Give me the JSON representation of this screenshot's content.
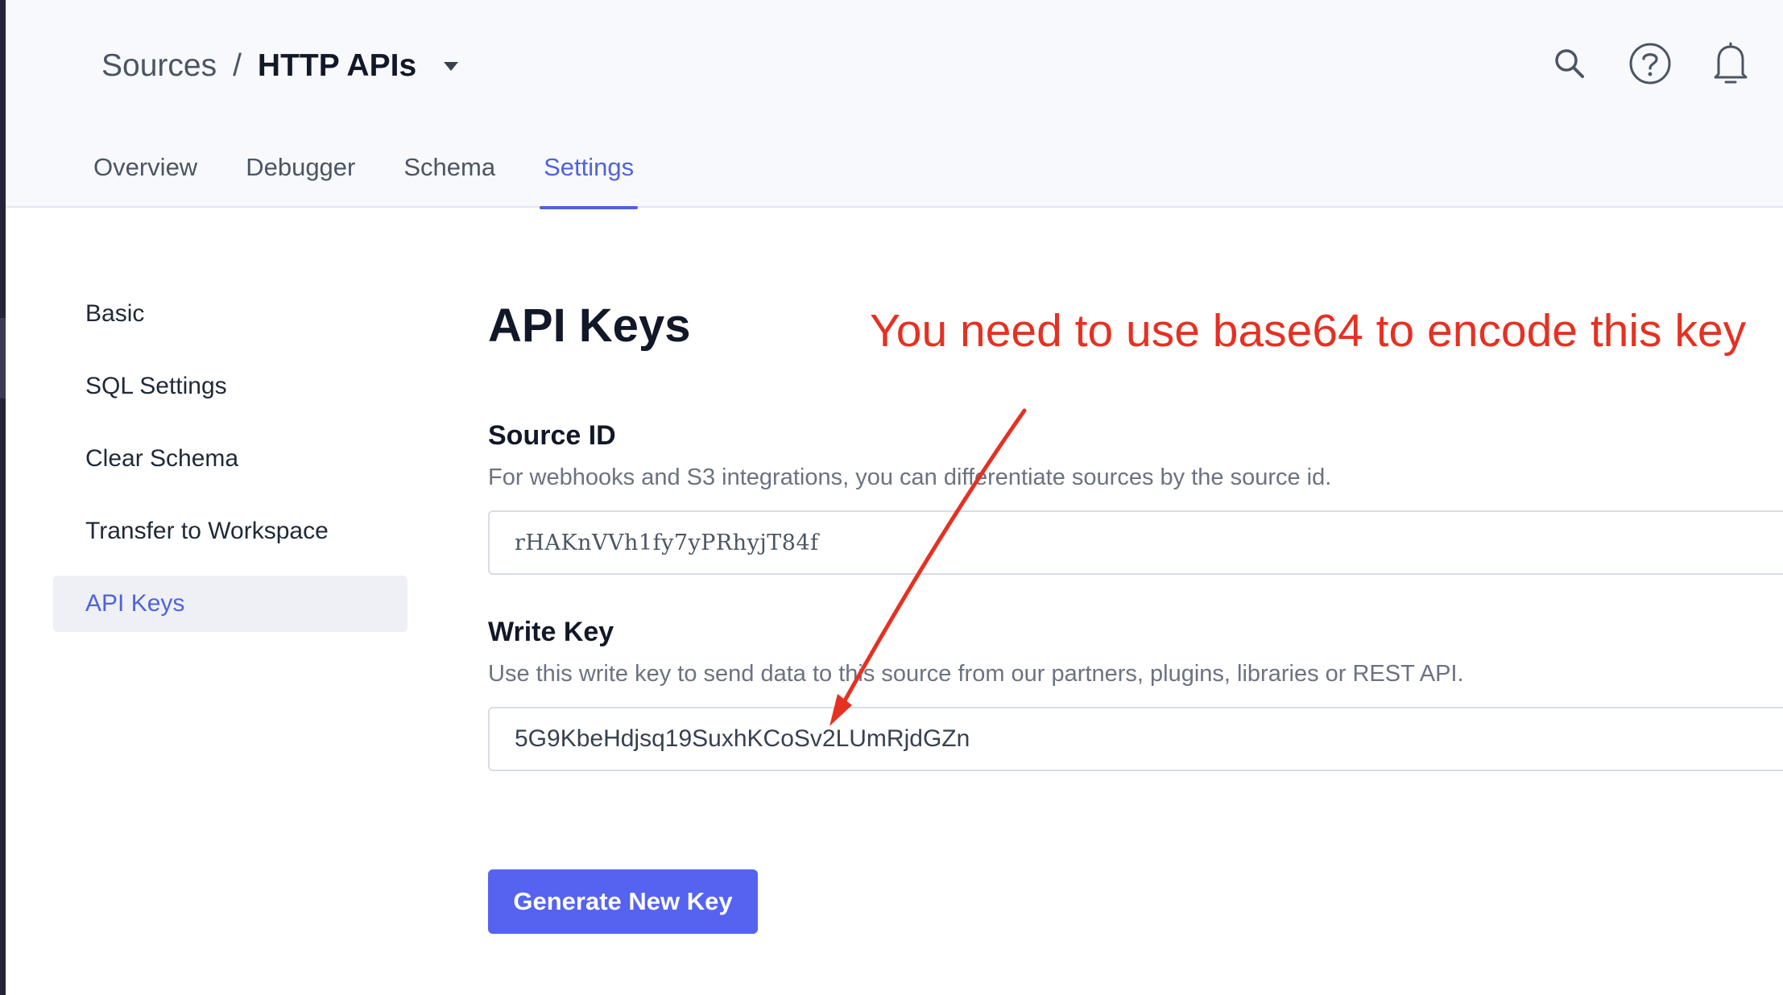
{
  "header": {
    "breadcrumb_root": "Sources",
    "breadcrumb_separator": "/",
    "breadcrumb_current": "HTTP APIs",
    "icons": [
      "search-icon",
      "help-icon",
      "bell-icon"
    ]
  },
  "tabs": [
    {
      "label": "Overview",
      "active": false
    },
    {
      "label": "Debugger",
      "active": false
    },
    {
      "label": "Schema",
      "active": false
    },
    {
      "label": "Settings",
      "active": true
    }
  ],
  "sidebar": {
    "items": [
      {
        "label": "Basic",
        "active": false
      },
      {
        "label": "SQL Settings",
        "active": false
      },
      {
        "label": "Clear Schema",
        "active": false
      },
      {
        "label": "Transfer to Workspace",
        "active": false
      },
      {
        "label": "API Keys",
        "active": true
      }
    ]
  },
  "main": {
    "title": "API Keys",
    "source_id": {
      "label": "Source ID",
      "description": "For webhooks and S3 integrations, you can differentiate sources by the source id.",
      "value": "rHAKnVVh1fy7yPRhyjT84f"
    },
    "write_key": {
      "label": "Write Key",
      "description": "Use this write key to send data to this source from our partners, plugins, libraries or REST API.",
      "value": "5G9KbeHdjsq19SuxhKCoSv2LUmRjdGZn"
    },
    "generate_button": "Generate New Key"
  },
  "annotation": {
    "text": "You need to use base64 to encode this key",
    "color": "#e53122"
  },
  "colors": {
    "accent": "#4f63d8",
    "button": "#5563f0",
    "header_bg": "#f8f9fc"
  }
}
